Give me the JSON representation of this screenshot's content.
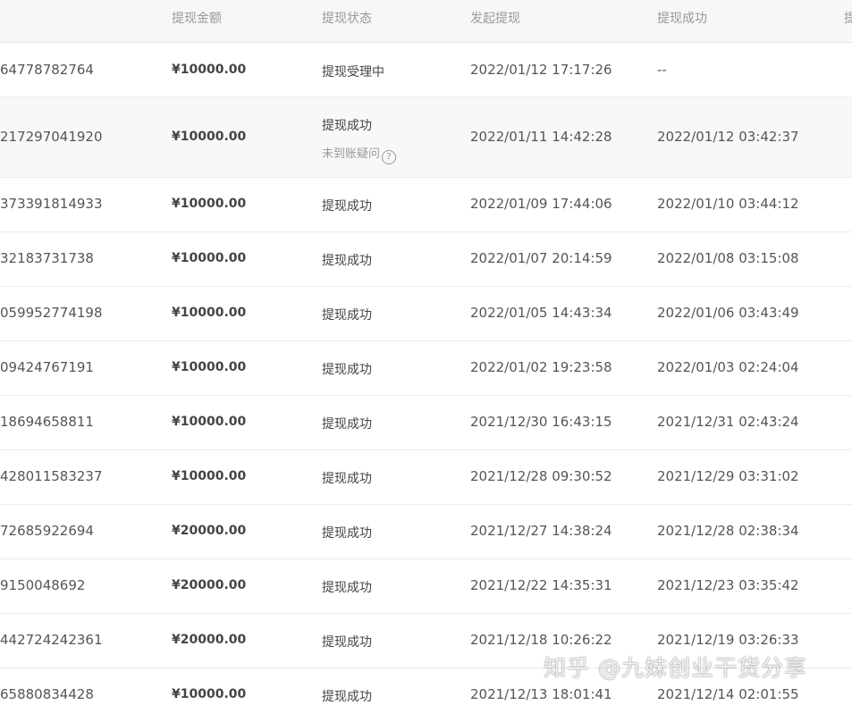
{
  "header": {
    "col_amount": "提现金额",
    "col_status": "提现状态",
    "col_start": "发起提现",
    "col_done": "提现成功",
    "col_extra": "提"
  },
  "rows": [
    {
      "id": "64778782764",
      "amount": "¥10000.00",
      "status": "提现受理中",
      "start": "2022/01/12 17:17:26",
      "done": "--"
    },
    {
      "id": "217297041920",
      "amount": "¥10000.00",
      "status": "提现成功",
      "note": "未到账疑问",
      "start": "2022/01/11 14:42:28",
      "done": "2022/01/12 03:42:37"
    },
    {
      "id": "373391814933",
      "amount": "¥10000.00",
      "status": "提现成功",
      "start": "2022/01/09 17:44:06",
      "done": "2022/01/10 03:44:12"
    },
    {
      "id": "32183731738",
      "amount": "¥10000.00",
      "status": "提现成功",
      "start": "2022/01/07 20:14:59",
      "done": "2022/01/08 03:15:08"
    },
    {
      "id": "059952774198",
      "amount": "¥10000.00",
      "status": "提现成功",
      "start": "2022/01/05 14:43:34",
      "done": "2022/01/06 03:43:49"
    },
    {
      "id": "09424767191",
      "amount": "¥10000.00",
      "status": "提现成功",
      "start": "2022/01/02 19:23:58",
      "done": "2022/01/03 02:24:04"
    },
    {
      "id": "18694658811",
      "amount": "¥10000.00",
      "status": "提现成功",
      "start": "2021/12/30 16:43:15",
      "done": "2021/12/31 02:43:24"
    },
    {
      "id": "428011583237",
      "amount": "¥10000.00",
      "status": "提现成功",
      "start": "2021/12/28 09:30:52",
      "done": "2021/12/29 03:31:02"
    },
    {
      "id": "72685922694",
      "amount": "¥20000.00",
      "status": "提现成功",
      "start": "2021/12/27 14:38:24",
      "done": "2021/12/28 02:38:34"
    },
    {
      "id": "9150048692",
      "amount": "¥20000.00",
      "status": "提现成功",
      "start": "2021/12/22 14:35:31",
      "done": "2021/12/23 03:35:42"
    },
    {
      "id": "442724242361",
      "amount": "¥20000.00",
      "status": "提现成功",
      "start": "2021/12/18 10:26:22",
      "done": "2021/12/19 03:26:33"
    },
    {
      "id": "65880834428",
      "amount": "¥10000.00",
      "status": "提现成功",
      "start": "2021/12/13 18:01:41",
      "done": "2021/12/14 02:01:55"
    }
  ],
  "watermark": "知乎 @九妹创业干货分享",
  "icons": {
    "note_help": "question-circle-icon"
  },
  "colors": {
    "header_bg": "#f7f7f7",
    "text": "#555555",
    "muted": "#999999",
    "border": "#ececec"
  }
}
